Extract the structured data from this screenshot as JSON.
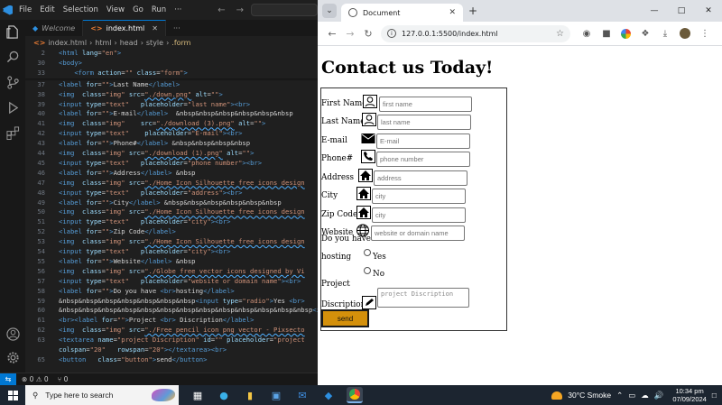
{
  "vscode": {
    "menu": [
      "File",
      "Edit",
      "Selection",
      "View",
      "Go",
      "Run",
      "···"
    ],
    "tabs": [
      {
        "label": "Welcome"
      },
      {
        "label": "index.html"
      }
    ],
    "breadcrumb": [
      "index.html",
      "html",
      "head",
      "style",
      ".form"
    ],
    "code_lines": [
      {
        "num": "2",
        "html": "<span class='t-tag'>&lt;html</span> <span class='t-attr'>lang</span>=<span class='t-str'>\"en\"</span><span class='t-tag'>&gt;</span>"
      },
      {
        "num": "30",
        "html": "<span class='t-tag'>&lt;body&gt;</span>"
      },
      {
        "num": "33",
        "html": "    <span class='t-tag'>&lt;form</span> <span class='t-attr'>action</span>=<span class='t-str'>\"\"</span> <span class='t-attr'>class</span>=<span class='t-str'>\"form\"</span><span class='t-tag'>&gt;</span>"
      },
      {
        "num": "37",
        "html": "<span class='t-tag'>&lt;label</span> <span class='t-attr'>for</span>=<span class='t-str'>\"\"</span><span class='t-tag'>&gt;</span><span class='t-txt'>Last Name</span><span class='t-tag'>&lt;/label&gt;</span>"
      },
      {
        "num": "38",
        "html": "<span class='t-tag'>&lt;img</span>  <span class='t-attr'>class</span>=<span class='t-str'>\"img\"</span> <span class='t-attr'>src</span>=<span class='t-str underline-str'>\"./down.png\"</span> <span class='t-attr'>alt</span>=<span class='t-str'>\"\"</span><span class='t-tag'>&gt;</span>"
      },
      {
        "num": "39",
        "html": "<span class='t-tag'>&lt;input</span> <span class='t-attr'>type</span>=<span class='t-str'>\"text\"</span>   <span class='t-attr'>placeholder</span>=<span class='t-str'>\"last name\"</span><span class='t-tag'>&gt;&lt;br&gt;</span>"
      },
      {
        "num": "40",
        "html": "<span class='t-tag'>&lt;label</span> <span class='t-attr'>for</span>=<span class='t-str'>\"\"</span><span class='t-tag'>&gt;</span><span class='t-txt'>E-mail</span><span class='t-tag'>&lt;/label&gt;</span>  <span class='t-ent'>&amp;nbsp&amp;nbsp&amp;nbsp&amp;nbsp&amp;nbsp&amp;nbsp</span>"
      },
      {
        "num": "41",
        "html": "<span class='t-tag'>&lt;img</span>  <span class='t-attr'>class</span>=<span class='t-str'>\"img\"</span>    <span class='t-attr'>src</span>=<span class='t-str underline-str'>\"./download (3).png\"</span> <span class='t-attr'>alt</span>=<span class='t-str'>\"\"</span><span class='t-tag'>&gt;</span>"
      },
      {
        "num": "42",
        "html": "<span class='t-tag'>&lt;input</span> <span class='t-attr'>type</span>=<span class='t-str'>\"text\"</span>    <span class='t-attr'>placeholder</span>=<span class='t-str'>\"E-mail\"</span><span class='t-tag'>&gt;&lt;br&gt;</span>"
      },
      {
        "num": "43",
        "html": "<span class='t-tag'>&lt;label</span> <span class='t-attr'>for</span>=<span class='t-str'>\"\"</span><span class='t-tag'>&gt;</span><span class='t-txt'>Phone#</span><span class='t-tag'>&lt;/label&gt;</span> <span class='t-ent'>&amp;nbsp&amp;nbsp&amp;nbsp&amp;nbsp</span>"
      },
      {
        "num": "44",
        "html": "<span class='t-tag'>&lt;img</span>  <span class='t-attr'>class</span>=<span class='t-str'>\"img\"</span> <span class='t-attr'>src</span>=<span class='t-str underline-str'>\"./download (1).png\"</span> <span class='t-attr'>alt</span>=<span class='t-str'>\"\"</span><span class='t-tag'>&gt;</span>"
      },
      {
        "num": "45",
        "html": "<span class='t-tag'>&lt;input</span> <span class='t-attr'>type</span>=<span class='t-str'>\"text\"</span>   <span class='t-attr'>placeholder</span>=<span class='t-str'>\"phone number\"</span><span class='t-tag'>&gt;&lt;br&gt;</span>"
      },
      {
        "num": "46",
        "html": "<span class='t-tag'>&lt;label</span> <span class='t-attr'>for</span>=<span class='t-str'>\"\"</span><span class='t-tag'>&gt;</span><span class='t-txt'>Address</span><span class='t-tag'>&lt;/label&gt;</span> <span class='t-ent'>&amp;nbsp</span>"
      },
      {
        "num": "47",
        "html": "<span class='t-tag'>&lt;img</span>  <span class='t-attr'>class</span>=<span class='t-str'>\"img\"</span> <span class='t-attr'>src</span>=<span class='t-str underline-str'>\"./Home Icon Silhouette free icons design</span>"
      },
      {
        "num": "48",
        "html": "<span class='t-tag'>&lt;input</span> <span class='t-attr'>type</span>=<span class='t-str'>\"text\"</span>   <span class='t-attr'>placeholder</span>=<span class='t-str'>\"address\"</span><span class='t-tag'>&gt;&lt;br&gt;</span>"
      },
      {
        "num": "49",
        "html": "<span class='t-tag'>&lt;label</span> <span class='t-attr'>for</span>=<span class='t-str'>\"\"</span><span class='t-tag'>&gt;</span><span class='t-txt'>City</span><span class='t-tag'>&lt;/label&gt;</span> <span class='t-ent'>&amp;nbsp&amp;nbsp&amp;nbsp&amp;nbsp&amp;nbsp&amp;nbsp</span>"
      },
      {
        "num": "50",
        "html": "<span class='t-tag'>&lt;img</span>  <span class='t-attr'>class</span>=<span class='t-str'>\"img\"</span> <span class='t-attr'>src</span>=<span class='t-str underline-str'>\"./Home Icon Silhouette free icons design</span>"
      },
      {
        "num": "51",
        "html": "<span class='t-tag'>&lt;input</span> <span class='t-attr'>type</span>=<span class='t-str'>\"text\"</span>   <span class='t-attr'>placeholder</span>=<span class='t-str'>\"city\"</span><span class='t-tag'>&gt;&lt;br&gt;</span>"
      },
      {
        "num": "52",
        "html": "<span class='t-tag'>&lt;label</span> <span class='t-attr'>for</span>=<span class='t-str'>\"\"</span><span class='t-tag'>&gt;</span><span class='t-txt'>Zip Code</span><span class='t-tag'>&lt;/label&gt;</span>"
      },
      {
        "num": "53",
        "html": "<span class='t-tag'>&lt;img</span>  <span class='t-attr'>class</span>=<span class='t-str'>\"img\"</span> <span class='t-attr'>src</span>=<span class='t-str underline-str'>\"./Home Icon Silhouette free icons design</span>"
      },
      {
        "num": "54",
        "html": "<span class='t-tag'>&lt;input</span> <span class='t-attr'>type</span>=<span class='t-str'>\"text\"</span>   <span class='t-attr'>placeholder</span>=<span class='t-str'>\"city\"</span><span class='t-tag'>&gt;&lt;br&gt;</span>"
      },
      {
        "num": "55",
        "html": "<span class='t-tag'>&lt;label</span> <span class='t-attr'>for</span>=<span class='t-str'>\"\"</span><span class='t-tag'>&gt;</span><span class='t-txt'>Website</span><span class='t-tag'>&lt;/label&gt;</span> <span class='t-ent'>&amp;nbsp</span>"
      },
      {
        "num": "56",
        "html": "<span class='t-tag'>&lt;img</span>  <span class='t-attr'>class</span>=<span class='t-str'>\"img\"</span> <span class='t-attr'>src</span>=<span class='t-str underline-str'>\"./Globe free vector icons designed by Vi</span>"
      },
      {
        "num": "57",
        "html": "<span class='t-tag'>&lt;input</span> <span class='t-attr'>type</span>=<span class='t-str'>\"text\"</span>   <span class='t-attr'>placeholder</span>=<span class='t-str'>\"website or domain name\"</span><span class='t-tag'>&gt;&lt;br&gt;</span>"
      },
      {
        "num": "58",
        "html": "<span class='t-tag'>&lt;label</span> <span class='t-attr'>for</span>=<span class='t-str'>\"\"</span><span class='t-tag'>&gt;</span><span class='t-txt'>Do you have </span><span class='t-tag'>&lt;br&gt;</span><span class='t-txt'>hosting</span><span class='t-tag'>&lt;/label&gt;</span>"
      },
      {
        "num": "59",
        "html": "<span class='t-ent'>&amp;nbsp&amp;nbsp&amp;nbsp&amp;nbsp&amp;nbsp&amp;nbsp&amp;nbsp</span><span class='t-tag'>&lt;input</span> <span class='t-attr'>type</span>=<span class='t-str'>\"radio\"</span><span class='t-tag'>&gt;</span><span class='t-txt'>Yes </span><span class='t-tag'>&lt;br&gt;</span>"
      },
      {
        "num": "60",
        "html": "<span class='t-ent'>&amp;nbsp&amp;nbsp&amp;nbsp&amp;nbsp&amp;nbsp&amp;nbsp&amp;nbsp&amp;nbsp&amp;nbsp&amp;nbsp&amp;nbsp&amp;nbsp&amp;nbsp</span><span class='t-tag'>&lt;input</span> <span class='t-attr'>type</span>=<span class='t-str'>\"radio\"</span>"
      },
      {
        "num": "61",
        "html": "<span class='t-tag'>&lt;br&gt;&lt;label</span> <span class='t-attr'>for</span>=<span class='t-str'>\"\"</span><span class='t-tag'>&gt;</span><span class='t-txt'>Project </span><span class='t-tag'>&lt;br&gt;</span><span class='t-txt'> Discription</span><span class='t-tag'>&lt;/label&gt;</span>"
      },
      {
        "num": "62",
        "html": "<span class='t-tag'>&lt;img</span>  <span class='t-attr'>class</span>=<span class='t-str'>\"img\"</span> <span class='t-attr'>src</span>=<span class='t-str underline-str'>\"./Free pencil icon png vector - Pixsecto</span>"
      },
      {
        "num": "63",
        "html": "<span class='t-tag'>&lt;textarea</span> <span class='t-attr'>name</span>=<span class='t-str'>\"project Discription\"</span> <span class='t-attr'>id</span>=<span class='t-str'>\"\"</span> <span class='t-attr'>placeholder</span>=<span class='t-str'>\"project</span>"
      },
      {
        "num": "",
        "html": "<span class='t-attr'>colspan</span>=<span class='t-str'>\"20\"</span>   <span class='t-attr'>rowspan</span>=<span class='t-str'>\"20\"</span><span class='t-tag'>&gt;&lt;/textarea&gt;&lt;br&gt;</span>"
      },
      {
        "num": "65",
        "html": "<span class='t-tag'>&lt;button</span>   <span class='t-attr'>class</span>=<span class='t-str'>\"button\"</span><span class='t-tag'>&gt;</span><span class='t-txt'>send</span><span class='t-tag'>&lt;/button&gt;</span>"
      }
    ],
    "status": {
      "errors": "⊗ 0 ⚠ 0",
      "ports": "⑂ 0"
    }
  },
  "chrome": {
    "tab_title": "Document",
    "url": "127.0.0.1:5500/index.html",
    "page": {
      "heading": "Contact us Today!",
      "fields": [
        {
          "label": "First Name",
          "placeholder": "first name",
          "icon": "user-icon"
        },
        {
          "label": "Last Name",
          "placeholder": "last name",
          "icon": "user-icon"
        },
        {
          "label": "E-mail",
          "placeholder": "E-mail",
          "icon": "mail-icon"
        },
        {
          "label": "Phone#",
          "placeholder": "phone number",
          "icon": "phone-icon"
        },
        {
          "label": "Address",
          "placeholder": "address",
          "icon": "home-icon"
        },
        {
          "label": "City",
          "placeholder": "city",
          "icon": "home-icon"
        },
        {
          "label": "Zip Code",
          "placeholder": "city",
          "icon": "home-icon"
        },
        {
          "label": "Website",
          "placeholder": "website or domain name",
          "icon": "globe-icon"
        }
      ],
      "hosting_label_1": "Do you have",
      "hosting_label_2": "hosting",
      "radio_yes": "Yes",
      "radio_no": "No",
      "project_label_1": "Project",
      "project_label_2": "Discription",
      "textarea_placeholder": "project Discription",
      "send_label": "send",
      "send_color": "#d4900b"
    }
  },
  "taskbar": {
    "search_placeholder": "Type here to search",
    "weather": "30°C  Smoke",
    "time": "10:34 pm",
    "date": "07/09/2024"
  }
}
